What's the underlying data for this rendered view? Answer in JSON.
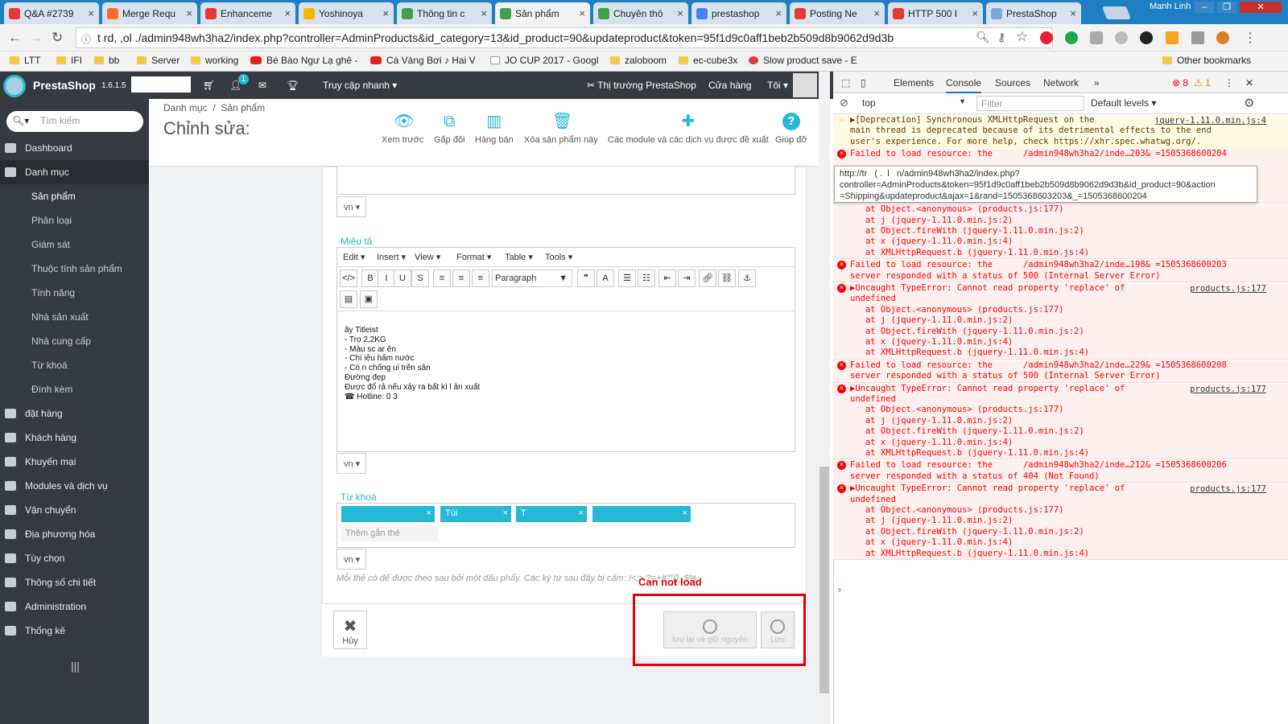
{
  "browser": {
    "tabs": [
      {
        "title": "Q&A #2739",
        "color": "#e53935",
        "active": false
      },
      {
        "title": "Merge Requ",
        "color": "#fc6d26",
        "active": false
      },
      {
        "title": "Enhanceme",
        "color": "#e53935",
        "active": false
      },
      {
        "title": "Yoshinoya",
        "color": "#f5b800",
        "active": false
      },
      {
        "title": "Thông tin c",
        "color": "#43a047",
        "active": false
      },
      {
        "title": "Sản phẩm",
        "color": "#43a047",
        "active": true
      },
      {
        "title": "Chuyên thô",
        "color": "#43a047",
        "active": false
      },
      {
        "title": "prestashop",
        "color": "#4285f4",
        "active": false
      },
      {
        "title": "Posting Ne",
        "color": "#e53935",
        "active": false
      },
      {
        "title": "HTTP 500 I",
        "color": "#e53935",
        "active": false
      },
      {
        "title": "PrestaShop",
        "color": "#7aa9d6",
        "active": false
      }
    ],
    "user": "Manh Linh",
    "url": "t   rd,  ,ol     ./admin948wh3ha2/index.php?controller=AdminProducts&id_category=13&id_product=90&updateproduct&token=95f1d9c0aff1beb2b509d8b9062d9d3b",
    "bookmarks": [
      "LTT",
      "IFI",
      "bb",
      "Server",
      "working",
      "Bé Bào Ngư Lạ ghê -",
      "Cá Vàng Bơi ♪ Hai V",
      "JO CUP 2017 - Googl",
      "zaloboom",
      "ec-cube3x",
      "Slow product save - E"
    ],
    "other_bookmarks": "Other bookmarks"
  },
  "ps": {
    "brand": "PrestaShop",
    "version": "1.6.1.5",
    "quick_access": "Truy cập nhanh",
    "marketplace": "Thị trường PrestaShop",
    "store": "Cửa hàng",
    "me": "Tôi",
    "badge": "1",
    "search_placeholder": "Tìm kiếm",
    "menu": [
      {
        "label": "Dashboard",
        "active": false
      },
      {
        "label": "Danh mục",
        "active": true
      },
      {
        "label": "đặt hàng",
        "active": false
      },
      {
        "label": "Khách hàng",
        "active": false
      },
      {
        "label": "Khuyến mại",
        "active": false
      },
      {
        "label": "Modules và dịch vụ",
        "active": false
      },
      {
        "label": "Vận chuyển",
        "active": false
      },
      {
        "label": "Địa phương hóa",
        "active": false
      },
      {
        "label": "Tùy chọn",
        "active": false
      },
      {
        "label": "Thông số chi tiết",
        "active": false
      },
      {
        "label": "Administration",
        "active": false
      },
      {
        "label": "Thống kê",
        "active": false
      }
    ],
    "submenu": [
      "Sản phẩm",
      "Phân loại",
      "Giám sát",
      "Thuộc tính sản phẩm",
      "Tính năng",
      "Nhà sản xuất",
      "Nhà cung cấp",
      "Từ khoá",
      "Đính kèm"
    ],
    "breadcrumb": [
      "Danh mục",
      "/",
      "Sản phẩm"
    ],
    "page_title": "Chỉnh sửa:",
    "toolbar": [
      "Xem trước",
      "Gấp đôi",
      "Hàng bán",
      "Xóa sản phẩm này",
      "Các module và các dịch vụ được đề xuất",
      "Giúp đỡ"
    ],
    "lang": "vn",
    "desc_label": "Miêu tả",
    "editor_menu": [
      "Edit",
      "Insert",
      "View",
      "Format",
      "Table",
      "Tools"
    ],
    "format_select": "Paragraph",
    "desc_lines": [
      "     ây Titleist",
      "- Trọ        2,2KG",
      "- Màu    sc    ar    ên",
      "- Chí   iệu              hấm nước",
      "- Có    n chống              ui trên sân",
      "Đường                   đẹp",
      "Được đổ    rả nếu xảy ra bất kì l                ản xuất",
      "☎ Hotline: 0               3"
    ],
    "tags_label": "Từ khoá",
    "tags": [
      "    ",
      "Túi     ",
      "T       ",
      "   "
    ],
    "tag_placeholder": "Thêm gắn thẻ",
    "tag_hint": "Mỗi thẻ có để được theo sau bởi một dấu phẩy. Các ký tự sau đây bị cấm: !<;>;?=+#\"°{}_$%",
    "cancel": "Hủy",
    "save_stay": "lưu lại và giữ nguyên",
    "save": "Lưu",
    "annotation": "Can not load",
    "annotation_color": "#e0000e"
  },
  "devtools": {
    "tabs": [
      "Elements",
      "Console",
      "Sources",
      "Network"
    ],
    "errors": "8",
    "warnings": "1",
    "context": "top",
    "filter_placeholder": "Filter",
    "levels": "Default levels",
    "messages": [
      {
        "type": "warn",
        "text": "▶[Deprecation] Synchronous XMLHttpRequest on the\nmain thread is deprecated because of its detrimental effects to the end\nuser's experience. For more help, check https://xhr.spec.whatwg.org/.",
        "src": "jquery-1.11.0.min.js:4"
      },
      {
        "type": "err",
        "text": "Failed to load resource: the      /admin948wh3ha2/inde…203& =1505368600204\n\n\n\n",
        "src": ""
      },
      {
        "type": "err",
        "text": "   at Object.<anonymous> (products.js:177)\n   at j (jquery-1.11.0.min.js:2)\n   at Object.fireWith (jquery-1.11.0.min.js:2)\n   at x (jquery-1.11.0.min.js:4)\n   at XMLHttpRequest.b (jquery-1.11.0.min.js:4)",
        "src": ""
      },
      {
        "type": "err",
        "text": "Failed to load resource: the      /admin948wh3ha2/inde…198& =1505368600203\nserver responded with a status of 500 (Internal Server Error)",
        "src": ""
      },
      {
        "type": "err",
        "text": "▶Uncaught TypeError: Cannot read property 'replace' of\nundefined\n   at Object.<anonymous> (products.js:177)\n   at j (jquery-1.11.0.min.js:2)\n   at Object.fireWith (jquery-1.11.0.min.js:2)\n   at x (jquery-1.11.0.min.js:4)\n   at XMLHttpRequest.b (jquery-1.11.0.min.js:4)",
        "src": "products.js:177"
      },
      {
        "type": "err",
        "text": "Failed to load resource: the      /admin948wh3ha2/inde…229& =1505368600208\nserver responded with a status of 500 (Internal Server Error)",
        "src": ""
      },
      {
        "type": "err",
        "text": "▶Uncaught TypeError: Cannot read property 'replace' of\nundefined\n   at Object.<anonymous> (products.js:177)\n   at j (jquery-1.11.0.min.js:2)\n   at Object.fireWith (jquery-1.11.0.min.js:2)\n   at x (jquery-1.11.0.min.js:4)\n   at XMLHttpRequest.b (jquery-1.11.0.min.js:4)",
        "src": "products.js:177"
      },
      {
        "type": "err",
        "text": "Failed to load resource: the      /admin948wh3ha2/inde…212& =1505368600206\nserver responded with a status of 404 (Not Found)",
        "src": ""
      },
      {
        "type": "err",
        "text": "▶Uncaught TypeError: Cannot read property 'replace' of\nundefined\n   at Object.<anonymous> (products.js:177)\n   at j (jquery-1.11.0.min.js:2)\n   at Object.fireWith (jquery-1.11.0.min.js:2)\n   at x (jquery-1.11.0.min.js:4)\n   at XMLHttpRequest.b (jquery-1.11.0.min.js:4)",
        "src": "products.js:177"
      }
    ],
    "tooltip": "http://tr   ( .  l   n/admin948wh3ha2/index.php?\ncontroller=AdminProducts&token=95f1d9c0aff1beb2b509d8b9062d9d3b&id_product=90&action\n=Shipping&updateproduct&ajax=1&rand=1505368603203&_=1505368600204"
  }
}
